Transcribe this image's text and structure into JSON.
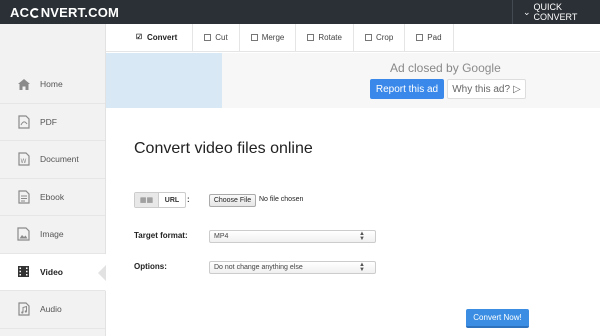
{
  "app": {
    "logo_left": "AC",
    "logo_right": "NVERT.COM",
    "quick_convert": "QUICK CONVERT"
  },
  "sidebar": {
    "items": [
      {
        "label": "Home",
        "icon": "home-icon"
      },
      {
        "label": "PDF",
        "icon": "pdf-icon"
      },
      {
        "label": "Document",
        "icon": "document-icon"
      },
      {
        "label": "Ebook",
        "icon": "ebook-icon"
      },
      {
        "label": "Image",
        "icon": "image-icon"
      },
      {
        "label": "Video",
        "icon": "video-icon",
        "active": true
      },
      {
        "label": "Audio",
        "icon": "audio-icon"
      }
    ]
  },
  "tabs": [
    {
      "label": "Convert",
      "checked": true
    },
    {
      "label": "Cut",
      "checked": false
    },
    {
      "label": "Merge",
      "checked": false
    },
    {
      "label": "Rotate",
      "checked": false
    },
    {
      "label": "Crop",
      "checked": false
    },
    {
      "label": "Pad",
      "checked": false
    }
  ],
  "ad": {
    "closed_prefix": "Ad closed by",
    "closed_brand": "Google",
    "report": "Report this ad",
    "why": "Why this ad?"
  },
  "main": {
    "title": "Convert video files online",
    "source": {
      "url_label": "URL",
      "colon": ":",
      "choose_button": "Choose File",
      "no_file": "No file chosen"
    },
    "target_format": {
      "label": "Target format:",
      "value": "MP4"
    },
    "options": {
      "label": "Options:",
      "value": "Do not change anything else"
    },
    "convert_button": "Convert Now!"
  },
  "colors": {
    "topbar": "#2b3036",
    "accent_blue": "#3a88e9",
    "ad_blue_panel": "#d8e8f4"
  }
}
